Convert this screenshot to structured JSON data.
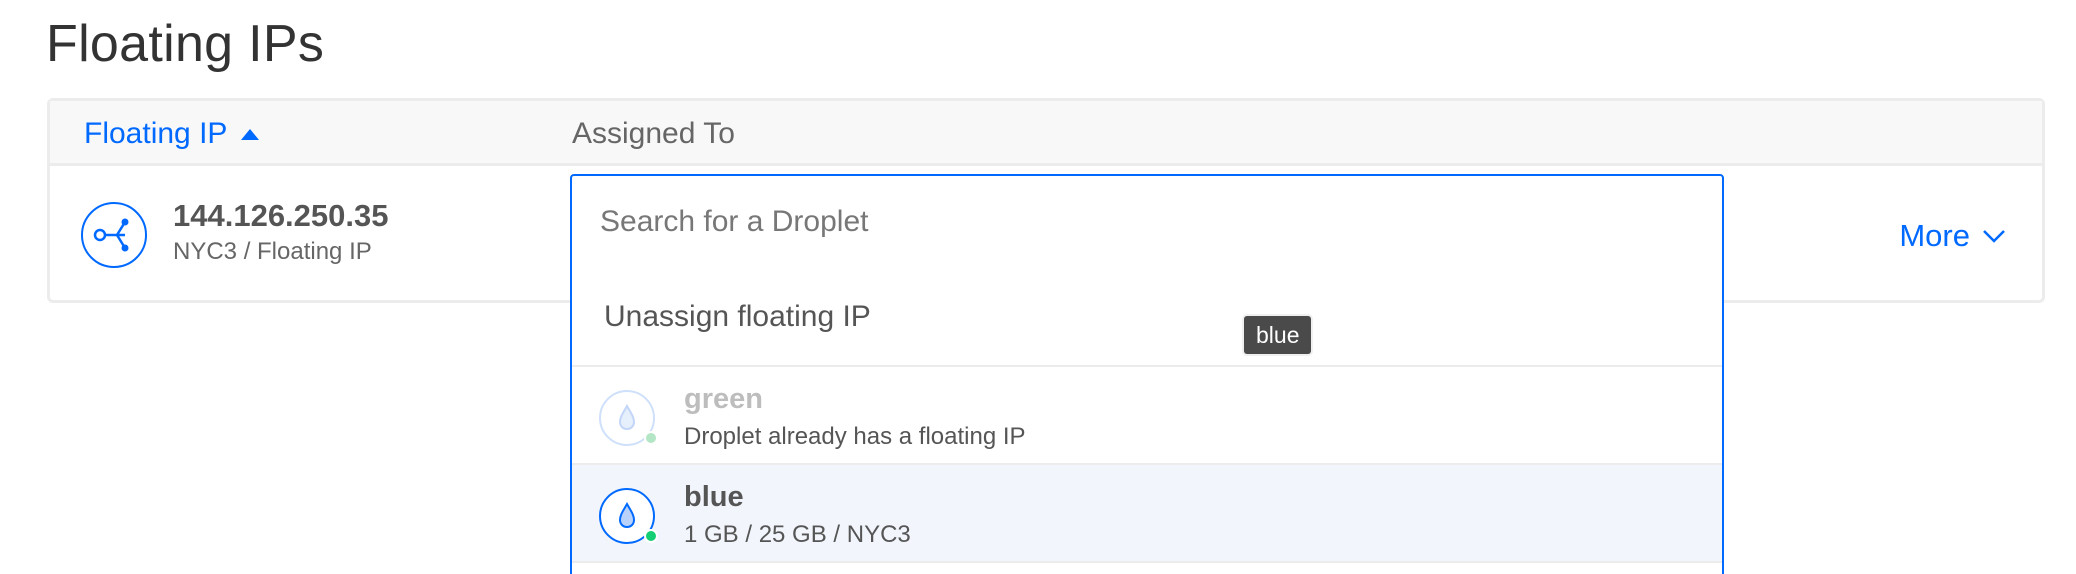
{
  "page": {
    "title": "Floating IPs"
  },
  "table": {
    "headers": {
      "floating_ip": "Floating IP",
      "assigned_to": "Assigned To"
    },
    "rows": [
      {
        "ip": "144.126.250.35",
        "region": "NYC3 / Floating IP",
        "more_label": "More"
      }
    ]
  },
  "search": {
    "placeholder": "Search for a Droplet",
    "value": ""
  },
  "dropdown": {
    "unassign_label": "Unassign floating IP",
    "options": [
      {
        "name": "green",
        "subtitle": "Droplet already has a floating IP",
        "status_color": "#b3e6c4",
        "disabled": true
      },
      {
        "name": "blue",
        "subtitle": "1 GB / 25 GB / NYC3",
        "status_color": "#15cd72",
        "disabled": false
      }
    ]
  },
  "tooltip": {
    "text": "blue"
  },
  "colors": {
    "accent": "#0069ff",
    "border": "#ececec",
    "header_bg": "#f8f8f8"
  },
  "icons": {
    "ip": "floating-ip-share-icon",
    "sort": "caret-up-icon",
    "more": "chevron-down-icon",
    "droplet": "droplet-icon"
  }
}
